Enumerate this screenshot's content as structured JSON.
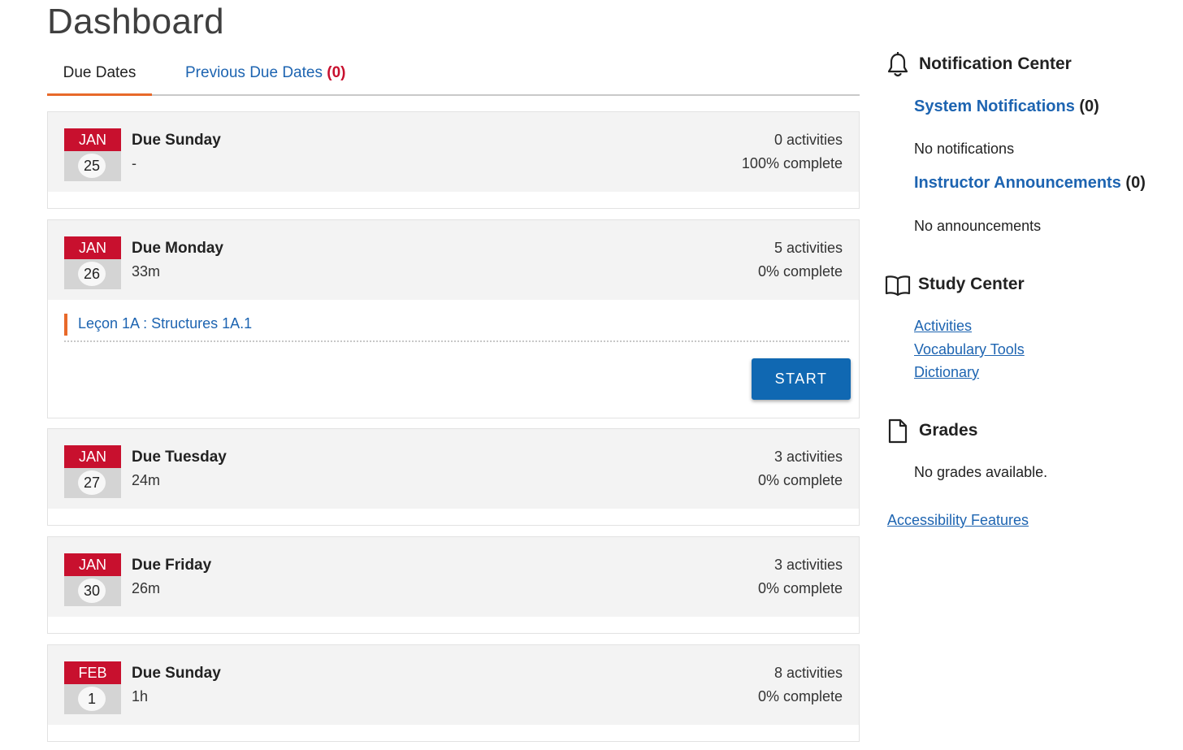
{
  "page": {
    "title": "Dashboard"
  },
  "tabs": {
    "due_dates": "Due Dates",
    "previous_label": "Previous Due Dates",
    "previous_count": "(0)"
  },
  "due_items": [
    {
      "month": "JAN",
      "day": "25",
      "title": "Due Sunday",
      "time": "-",
      "activities": "0 activities",
      "complete": "100% complete"
    },
    {
      "month": "JAN",
      "day": "26",
      "title": "Due Monday",
      "time": "33m",
      "activities": "5 activities",
      "complete": "0% complete",
      "activity": {
        "link": "Leçon 1A : Structures 1A.1",
        "button": "START"
      }
    },
    {
      "month": "JAN",
      "day": "27",
      "title": "Due Tuesday",
      "time": "24m",
      "activities": "3 activities",
      "complete": "0% complete"
    },
    {
      "month": "JAN",
      "day": "30",
      "title": "Due Friday",
      "time": "26m",
      "activities": "3 activities",
      "complete": "0% complete"
    },
    {
      "month": "FEB",
      "day": "1",
      "title": "Due Sunday",
      "time": "1h",
      "activities": "8 activities",
      "complete": "0% complete"
    }
  ],
  "sidebar": {
    "notification_center": {
      "title": "Notification Center",
      "icon": "bell-icon",
      "system_label": "System Notifications",
      "system_count": "(0)",
      "system_empty": "No notifications",
      "instructor_label": "Instructor Announcements",
      "instructor_count": "(0)",
      "instructor_empty": "No announcements"
    },
    "study_center": {
      "title": "Study Center",
      "icon": "book-icon",
      "links": [
        "Activities",
        "Vocabulary Tools",
        "Dictionary"
      ]
    },
    "grades": {
      "title": "Grades",
      "icon": "document-icon",
      "empty": "No grades available."
    },
    "accessibility": "Accessibility Features"
  },
  "colors": {
    "accent_orange": "#e8692a",
    "calendar_red": "#c8102e",
    "link_blue": "#1d64b1",
    "button_blue": "#1068b2"
  }
}
